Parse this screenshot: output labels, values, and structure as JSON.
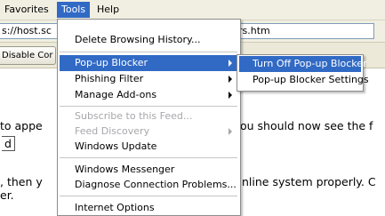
{
  "menubar": {
    "items": [
      "Favorites",
      "Tools",
      "Help"
    ]
  },
  "address": {
    "left_part": "s://host.sc",
    "right_part": "rs.htm"
  },
  "toolbar": {
    "disable_label": "Disable Cor"
  },
  "content": {
    "line1_left": "to appe",
    "line1_right": "ou should now see the f",
    "boxed_text": "d",
    "line2_left": ", then y",
    "line2_right": "nline system properly. C",
    "line3_left": "er."
  },
  "tools_menu": {
    "items": [
      {
        "label": "Delete Browsing History...",
        "enabled": true
      },
      {
        "label": "Pop-up Blocker",
        "enabled": true,
        "submenu": true,
        "highlighted": true
      },
      {
        "label": "Phishing Filter",
        "enabled": true,
        "submenu": true
      },
      {
        "label": "Manage Add-ons",
        "enabled": true,
        "submenu": true
      },
      {
        "label": "Subscribe to this Feed...",
        "enabled": false
      },
      {
        "label": "Feed Discovery",
        "enabled": false,
        "submenu": true
      },
      {
        "label": "Windows Update",
        "enabled": true
      },
      {
        "label": "Windows Messenger",
        "enabled": true
      },
      {
        "label": "Diagnose Connection Problems...",
        "enabled": true
      },
      {
        "label": "Internet Options",
        "enabled": true
      }
    ]
  },
  "popup_submenu": {
    "items": [
      {
        "label": "Turn Off Pop-up Blocker",
        "highlighted": true
      },
      {
        "label": "Pop-up Blocker Settings"
      }
    ]
  },
  "colors": {
    "highlight": "#316ac5",
    "menubar_bg": "#f1efe2",
    "disabled_text": "#a7a6aa"
  }
}
